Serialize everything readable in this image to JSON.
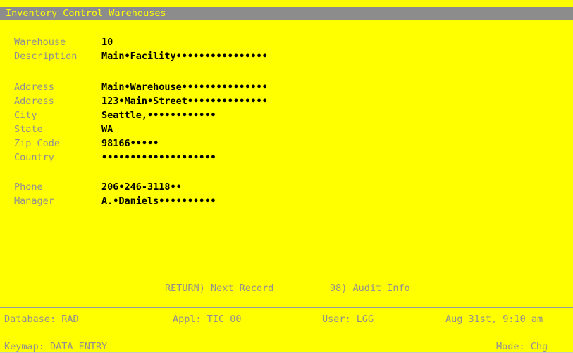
{
  "window": {
    "title": "Inventory Control Warehouses"
  },
  "fields": [
    {
      "label": "Warehouse",
      "value": "10"
    },
    {
      "label": "Description",
      "value": "Main•Facility••••••••••••••••"
    },
    {
      "label": "Address",
      "value": "Main•Warehouse•••••••••••••••"
    },
    {
      "label": "Address",
      "value": "123•Main•Street••••••••••••••"
    },
    {
      "label": "City",
      "value": "Seattle,••••••••••••"
    },
    {
      "label": "State",
      "value": "WA"
    },
    {
      "label": "Zip Code",
      "value": "98166•••••"
    },
    {
      "label": "Country",
      "value": "••••••••••••••••••••"
    },
    {
      "label": "Phone",
      "value": "206•246-3118••"
    },
    {
      "label": "Manager",
      "value": "A.•Daniels••••••••••"
    }
  ],
  "commands": {
    "next_record": "RETURN) Next Record",
    "audit_info": "98) Audit Info"
  },
  "status_bar": {
    "database": "Database: RAD",
    "appl": "Appl: TIC 00",
    "user": "User: LGG",
    "datetime": "Aug 31st, 9:10 am"
  },
  "bottom_bar": {
    "keymap": "Keymap: DATA ENTRY",
    "mode": "Mode: Chg"
  }
}
